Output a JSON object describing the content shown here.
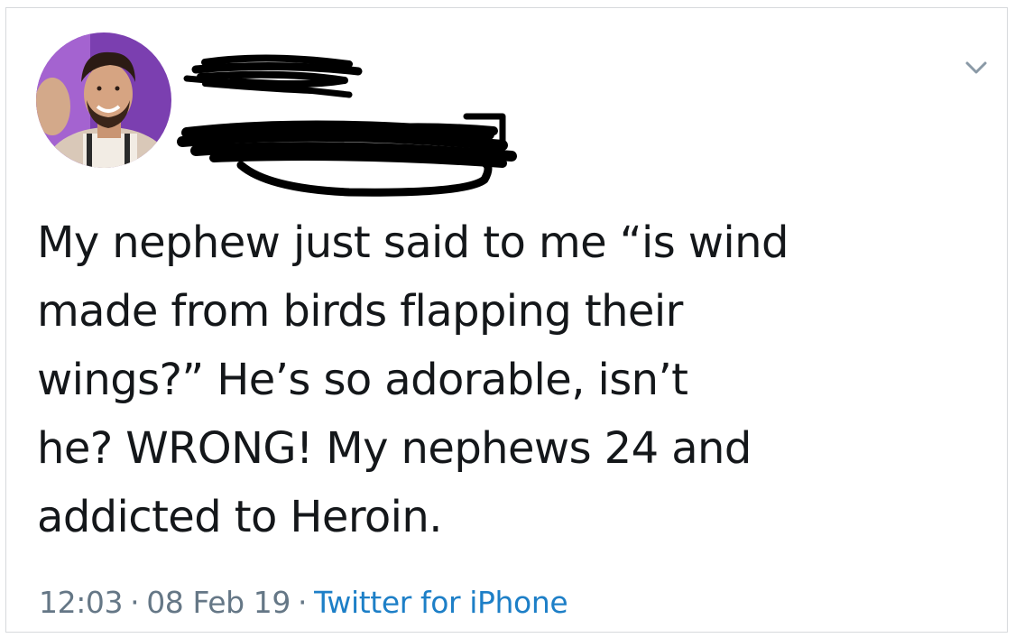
{
  "tweet": {
    "text": "My nephew just said to me “is wind\nmade from birds flapping their\nwings?” He’s so adorable, isn’t\nhe? WRONG! My nephews 24 and\naddicted to Heroin.",
    "time": "12:03",
    "date": "08 Feb 19",
    "separator": "·",
    "source": "Twitter for iPhone"
  },
  "author": {
    "display_name_redacted": true,
    "handle_redacted": true
  },
  "icons": {
    "menu": "chevron-down-icon"
  },
  "colors": {
    "text": "#14171a",
    "meta": "#657786",
    "link": "#1d7fc7",
    "border": "#d7d9dc"
  }
}
